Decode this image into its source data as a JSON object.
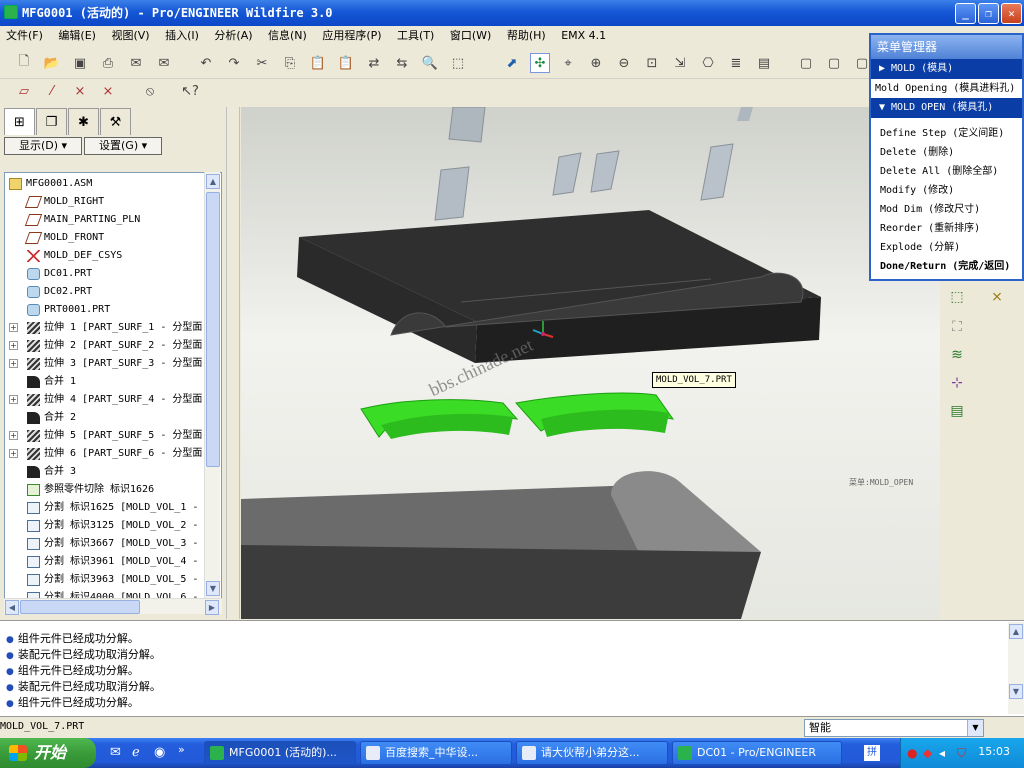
{
  "window": {
    "title": "MFG0001 (活动的) - Pro/ENGINEER Wildfire 3.0"
  },
  "menubar": [
    "文件(F)",
    "编辑(E)",
    "视图(V)",
    "插入(I)",
    "分析(A)",
    "信息(N)",
    "应用程序(P)",
    "工具(T)",
    "窗口(W)",
    "帮助(H)",
    "EMX 4.1"
  ],
  "navigator": {
    "show_button": "显示(D)",
    "settings_button": "设置(G)",
    "tree": [
      {
        "label": "MFG0001.ASM",
        "icon": "assembly-icon",
        "expander": false,
        "indent": 0
      },
      {
        "label": "MOLD_RIGHT",
        "icon": "datum-plane-icon",
        "expander": false,
        "indent": 1
      },
      {
        "label": "MAIN_PARTING_PLN",
        "icon": "datum-plane-icon",
        "expander": false,
        "indent": 1
      },
      {
        "label": "MOLD_FRONT",
        "icon": "datum-plane-icon",
        "expander": false,
        "indent": 1
      },
      {
        "label": "MOLD_DEF_CSYS",
        "icon": "csys-icon",
        "expander": false,
        "indent": 1
      },
      {
        "label": "DC01.PRT",
        "icon": "part-icon",
        "expander": false,
        "indent": 1
      },
      {
        "label": "DC02.PRT",
        "icon": "part-icon",
        "expander": false,
        "indent": 1
      },
      {
        "label": "PRT0001.PRT",
        "icon": "part-icon",
        "expander": false,
        "indent": 1
      },
      {
        "label": "拉伸 1 [PART_SURF_1 - 分型面",
        "icon": "extrude-surface-icon",
        "expander": true,
        "indent": 1
      },
      {
        "label": "拉伸 2 [PART_SURF_2 - 分型面",
        "icon": "extrude-surface-icon",
        "expander": true,
        "indent": 1
      },
      {
        "label": "拉伸 3 [PART_SURF_3 - 分型面",
        "icon": "extrude-surface-icon",
        "expander": true,
        "indent": 1
      },
      {
        "label": "合并 1",
        "icon": "merge-icon",
        "expander": false,
        "indent": 1
      },
      {
        "label": "拉伸 4 [PART_SURF_4 - 分型面",
        "icon": "extrude-surface-icon",
        "expander": true,
        "indent": 1
      },
      {
        "label": "合并 2",
        "icon": "merge-icon",
        "expander": false,
        "indent": 1
      },
      {
        "label": "拉伸 5 [PART_SURF_5 - 分型面",
        "icon": "extrude-surface-icon",
        "expander": true,
        "indent": 1
      },
      {
        "label": "拉伸 6 [PART_SURF_6 - 分型面",
        "icon": "extrude-surface-icon",
        "expander": true,
        "indent": 1
      },
      {
        "label": "合并 3",
        "icon": "merge-icon",
        "expander": false,
        "indent": 1
      },
      {
        "label": "参照零件切除 标识1626",
        "icon": "ref-cut-icon",
        "expander": false,
        "indent": 1
      },
      {
        "label": "分割 标识1625 [MOLD_VOL_1 -",
        "icon": "split-icon",
        "expander": false,
        "indent": 1
      },
      {
        "label": "分割 标识3125 [MOLD_VOL_2 -",
        "icon": "split-icon",
        "expander": false,
        "indent": 1
      },
      {
        "label": "分割 标识3667 [MOLD_VOL_3 -",
        "icon": "split-icon",
        "expander": false,
        "indent": 1
      },
      {
        "label": "分割 标识3961 [MOLD_VOL_4 -",
        "icon": "split-icon",
        "expander": false,
        "indent": 1
      },
      {
        "label": "分割 标识3963 [MOLD_VOL_5 -",
        "icon": "split-icon",
        "expander": false,
        "indent": 1
      },
      {
        "label": "分割 标识4000 [MOLD_VOL_6 -",
        "icon": "split-icon",
        "expander": false,
        "indent": 1
      }
    ]
  },
  "viewport": {
    "tooltip": "MOLD_VOL_7.PRT",
    "watermark": "bbs.chinade.net",
    "mode_label": "菜单:MOLD_OPEN"
  },
  "menu_manager": {
    "title": "菜单管理器",
    "section_mold": "▶ MOLD (模具)",
    "mold_opening": "Mold Opening (模具进料孔)",
    "section_open": "▼ MOLD OPEN (模具孔)",
    "items": [
      "Define Step (定义间距)",
      "Delete (删除)",
      "Delete All (删除全部)",
      "Modify (修改)",
      "Mod Dim (修改尺寸)",
      "Reorder (重新排序)",
      "Explode (分解)"
    ],
    "done": "Done/Return (完成/返回)"
  },
  "messages": [
    "组件元件已经成功分解。",
    "装配元件已经成功取消分解。",
    "组件元件已经成功分解。",
    "装配元件已经成功取消分解。",
    "组件元件已经成功分解。"
  ],
  "statusbar": {
    "text": "MOLD_VOL_7.PRT",
    "filter": "智能"
  },
  "taskbar": {
    "start": "开始",
    "tasks": [
      "MFG0001 (活动的)...",
      "百度搜索_中华设...",
      "请大伙帮小弟分这...",
      "DC01 - Pro/ENGINEER"
    ],
    "clock": "15:03"
  },
  "colors": {
    "accent": "#0a3da6",
    "selection_green": "#33dd22",
    "mold_dark": "#2e2e2e",
    "mold_light": "#6a6a6a"
  }
}
